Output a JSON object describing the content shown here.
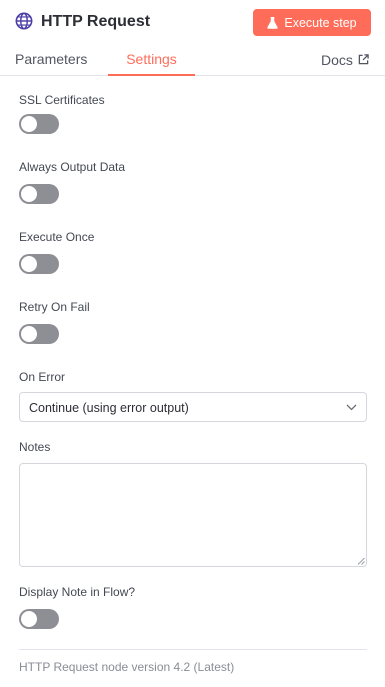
{
  "header": {
    "title": "HTTP Request",
    "icon": "globe-icon",
    "execute_label": "Execute step",
    "execute_icon": "flask-icon",
    "accent_color": "#ff6d5a"
  },
  "tabs": {
    "parameters": "Parameters",
    "settings": "Settings",
    "docs": "Docs",
    "active": "Settings"
  },
  "settings": {
    "ssl": {
      "label": "SSL Certificates",
      "enabled": false
    },
    "always_output": {
      "label": "Always Output Data",
      "enabled": false
    },
    "execute_once": {
      "label": "Execute Once",
      "enabled": false
    },
    "retry": {
      "label": "Retry On Fail",
      "enabled": false
    },
    "on_error": {
      "label": "On Error",
      "value": "Continue (using error output)"
    },
    "notes": {
      "label": "Notes",
      "value": ""
    },
    "display_note": {
      "label": "Display Note in Flow?",
      "enabled": false
    }
  },
  "footer": {
    "version": "HTTP Request node version 4.2 (Latest)"
  }
}
